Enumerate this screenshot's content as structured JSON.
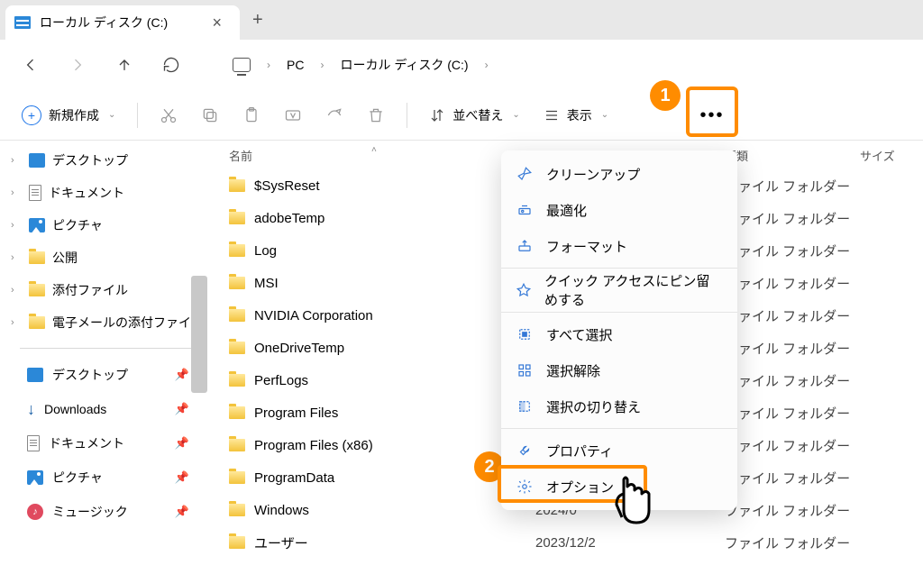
{
  "tab": {
    "title": "ローカル ディスク (C:)"
  },
  "breadcrumb": {
    "pc": "PC",
    "drive": "ローカル ディスク (C:)"
  },
  "toolbar": {
    "new": "新規作成",
    "sort": "並べ替え",
    "view": "表示"
  },
  "sidebar": {
    "tree": [
      {
        "label": "デスクトップ",
        "ico": "blue"
      },
      {
        "label": "ドキュメント",
        "ico": "doc"
      },
      {
        "label": "ピクチャ",
        "ico": "pic"
      },
      {
        "label": "公開",
        "ico": "folder"
      },
      {
        "label": "添付ファイル",
        "ico": "folder"
      },
      {
        "label": "電子メールの添付ファイ",
        "ico": "folder"
      }
    ],
    "quick": [
      {
        "label": "デスクトップ",
        "ico": "blue"
      },
      {
        "label": "Downloads",
        "ico": "dl"
      },
      {
        "label": "ドキュメント",
        "ico": "doc"
      },
      {
        "label": "ピクチャ",
        "ico": "pic"
      },
      {
        "label": "ミュージック",
        "ico": "music"
      }
    ]
  },
  "columns": {
    "name": "名前",
    "date": "",
    "type": "種類",
    "size": "サイズ"
  },
  "files": [
    {
      "name": "$SysReset",
      "date": "",
      "type": "ファイル フォルダー"
    },
    {
      "name": "adobeTemp",
      "date": "",
      "type": "ファイル フォルダー"
    },
    {
      "name": "Log",
      "date": "",
      "type": "ファイル フォルダー"
    },
    {
      "name": "MSI",
      "date": "",
      "type": "ファイル フォルダー"
    },
    {
      "name": "NVIDIA Corporation",
      "date": "",
      "type": "ファイル フォルダー"
    },
    {
      "name": "OneDriveTemp",
      "date": "",
      "type": "ファイル フォルダー"
    },
    {
      "name": "PerfLogs",
      "date": "",
      "type": "ファイル フォルダー"
    },
    {
      "name": "Program Files",
      "date": "",
      "type": "ファイル フォルダー"
    },
    {
      "name": "Program Files (x86)",
      "date": "",
      "type": "ファイル フォルダー"
    },
    {
      "name": "ProgramData",
      "date": "",
      "type": "ファイル フォルダー"
    },
    {
      "name": "Windows",
      "date": "2024/0",
      "type": "ファイル フォルダー"
    },
    {
      "name": "ユーザー",
      "date": "2023/12/2",
      "type": "ファイル フォルダー"
    }
  ],
  "menu": {
    "cleanup": "クリーンアップ",
    "optimize": "最適化",
    "format": "フォーマット",
    "pin": "クイック アクセスにピン留めする",
    "selectall": "すべて選択",
    "selectnone": "選択解除",
    "invert": "選択の切り替え",
    "properties": "プロパティ",
    "options": "オプション"
  },
  "badge1": "1",
  "badge2": "2"
}
